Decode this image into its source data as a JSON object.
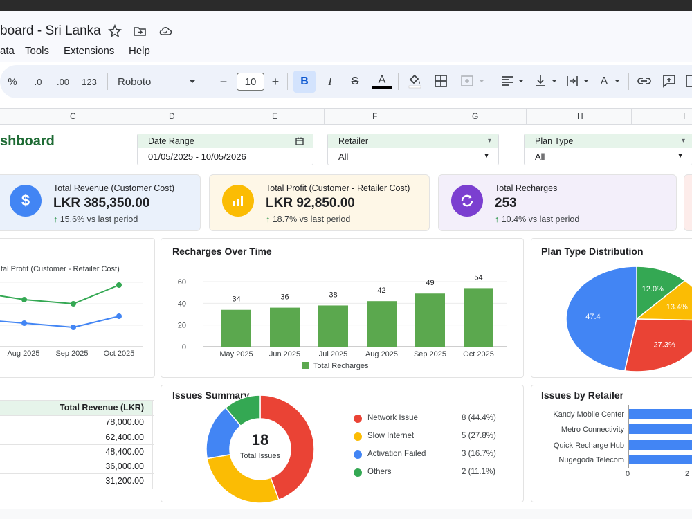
{
  "app": {
    "doc_title": "board - Sri Lanka",
    "menu": [
      "ata",
      "Tools",
      "Extensions",
      "Help"
    ]
  },
  "toolbar": {
    "percent": "%",
    "dec_less": ".0",
    "dec_more": ".00",
    "num_format": "123",
    "font": "Roboto",
    "font_size": "10",
    "minus": "−",
    "plus": "+",
    "bold": "B",
    "italic": "I",
    "strike": "S",
    "text_color": "A",
    "text_rotate": "A"
  },
  "columns": [
    "C",
    "D",
    "E",
    "F",
    "G",
    "H",
    "I"
  ],
  "sheet": {
    "title": "shboard"
  },
  "filters": [
    {
      "label": "Date Range",
      "value": "01/05/2025 - 10/05/2026"
    },
    {
      "label": "Retailer",
      "value": "All"
    },
    {
      "label": "Plan Type",
      "value": "All"
    }
  ],
  "kpis": [
    {
      "label": "Total Revenue (Customer Cost)",
      "value": "LKR 385,350.00",
      "delta": "15.6% vs last period",
      "icon": "$",
      "color": "#4285f4",
      "bg": "#eaf1fb"
    },
    {
      "label": "Total Profit (Customer - Retailer Cost)",
      "value": "LKR 92,850.00",
      "delta": "18.7% vs last period",
      "icon": "bar-chart-icon",
      "color": "#fbbc04",
      "bg": "#fef7e7"
    },
    {
      "label": "Total Recharges",
      "value": "253",
      "delta": "10.4% vs last period",
      "icon": "refresh-icon",
      "color": "#7b3fd0",
      "bg": "#f3effa"
    }
  ],
  "line_chart": {
    "legend_text": "tal Profit (Customer - Retailer Cost)",
    "x_labels": [
      "Aug 2025",
      "Sep 2025",
      "Oct 2025"
    ]
  },
  "chart_data": {
    "type": "bar",
    "title": "Recharges Over Time",
    "categories": [
      "May 2025",
      "Jun 2025",
      "Jul 2025",
      "Aug 2025",
      "Sep 2025",
      "Oct 2025"
    ],
    "series": [
      {
        "name": "Total Recharges",
        "values": [
          34,
          36,
          38,
          42,
          49,
          54
        ]
      }
    ],
    "y_ticks": [
      "0",
      "20",
      "40",
      "60"
    ],
    "ylim": [
      0,
      60
    ],
    "color": "#5ba84e"
  },
  "plan_pie": {
    "title": "Plan Type Distribution",
    "labels": [
      "12.0%",
      "13.4%",
      "27.3%",
      "47.4"
    ],
    "values": [
      12.0,
      13.4,
      27.3,
      47.3
    ],
    "colors": [
      "#34a853",
      "#fbbc04",
      "#ea4335",
      "#4285f4"
    ]
  },
  "issues": {
    "title": "Issues Summary",
    "total": "18",
    "total_label": "Total Issues",
    "items": [
      {
        "name": "Network Issue",
        "count": "8 (44.4%)",
        "color": "#ea4335",
        "value": 44.4
      },
      {
        "name": "Slow Internet",
        "count": "5 (27.8%)",
        "color": "#fbbc04",
        "value": 27.8
      },
      {
        "name": "Activation Failed",
        "count": "3 (16.7%)",
        "color": "#4285f4",
        "value": 16.7
      },
      {
        "name": "Others",
        "count": "2 (11.1%)",
        "color": "#34a853",
        "value": 11.1
      }
    ]
  },
  "retailer_issues": {
    "title": "Issues by Retailer",
    "retailers": [
      "Kandy Mobile Center",
      "Metro Connectivity",
      "Quick Recharge Hub",
      "Nugegoda Telecom"
    ],
    "x_ticks": [
      "0",
      "2"
    ]
  },
  "table": {
    "header": "Total Revenue (LKR)",
    "rows": [
      "78,000.00",
      "62,400.00",
      "48,400.00",
      "36,000.00",
      "31,200.00"
    ]
  }
}
